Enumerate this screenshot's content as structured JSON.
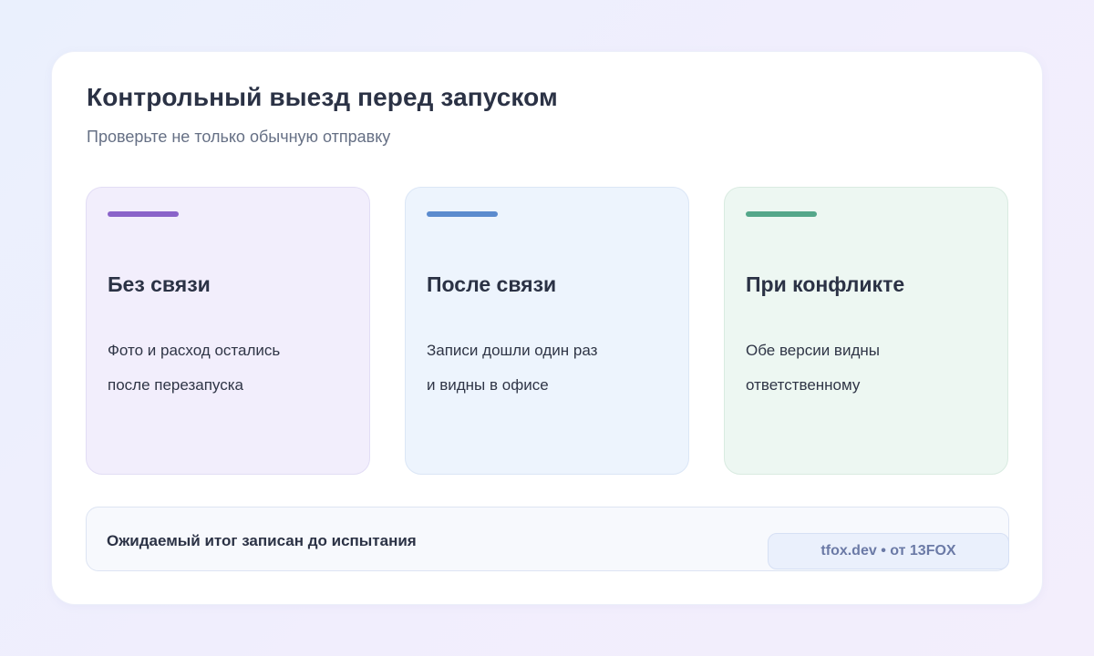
{
  "header": {
    "title": "Контрольный выезд перед запуском",
    "subtitle": "Проверьте не только обычную отправку"
  },
  "columns": [
    {
      "title": "Без связи",
      "lines": [
        "Фото и расход остались",
        "после перезапуска"
      ],
      "accent_color": "#8a63c9"
    },
    {
      "title": "После связи",
      "lines": [
        "Записи дошли один раз",
        "и видны в офисе"
      ],
      "accent_color": "#5b8bce"
    },
    {
      "title": "При конфликте",
      "lines": [
        "Обе версии видны",
        "ответственному"
      ],
      "accent_color": "#54a78a"
    }
  ],
  "footer": {
    "text": "Ожидаемый итог записан до испытания",
    "badge": "tfox.dev • от 13FOX"
  }
}
